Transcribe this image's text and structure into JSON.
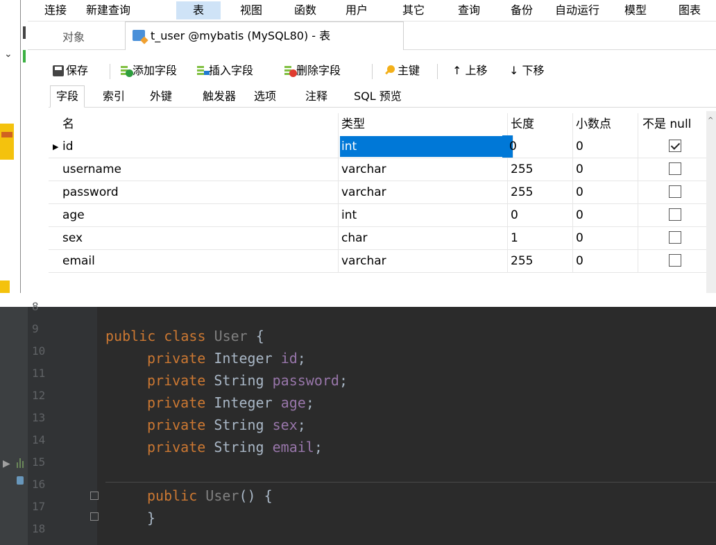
{
  "menubar": {
    "items": [
      "连接",
      "新建查询",
      "表",
      "视图",
      "函数",
      "用户",
      "其它",
      "查询",
      "备份",
      "自动运行",
      "模型",
      "图表"
    ],
    "active": "表"
  },
  "tabs": {
    "objects": "对象",
    "table_tab": "t_user @mybatis (MySQL80) - 表"
  },
  "toolbar": {
    "save": "保存",
    "add_field": "添加字段",
    "insert_field": "插入字段",
    "delete_field": "删除字段",
    "primary_key": "主键",
    "move_up": "↑ 上移",
    "move_down": "↓ 下移"
  },
  "subtabs": [
    "字段",
    "索引",
    "外键",
    "触发器",
    "选项",
    "注释",
    "SQL 预览"
  ],
  "grid": {
    "headers": [
      "名",
      "类型",
      "长度",
      "小数点",
      "不是 null"
    ],
    "rows": [
      {
        "name": "id",
        "type": "int",
        "length": "0",
        "decimals": "0",
        "not_null": true
      },
      {
        "name": "username",
        "type": "varchar",
        "length": "255",
        "decimals": "0",
        "not_null": false
      },
      {
        "name": "password",
        "type": "varchar",
        "length": "255",
        "decimals": "0",
        "not_null": false
      },
      {
        "name": "age",
        "type": "int",
        "length": "0",
        "decimals": "0",
        "not_null": false
      },
      {
        "name": "sex",
        "type": "char",
        "length": "1",
        "decimals": "0",
        "not_null": false
      },
      {
        "name": "email",
        "type": "varchar",
        "length": "255",
        "decimals": "0",
        "not_null": false
      }
    ]
  },
  "editor": {
    "line_numbers": [
      "8",
      "9",
      "10",
      "11",
      "12",
      "13",
      "14",
      "15",
      "16",
      "17",
      "18"
    ],
    "class_decl": {
      "kw1": "public",
      "kw2": "class",
      "name": "User",
      "brace": "{"
    },
    "fields": [
      {
        "kw": "private",
        "type": "Integer",
        "name": "id",
        "end": ";"
      },
      {
        "kw": "private",
        "type": "String",
        "name": "password",
        "end": ";"
      },
      {
        "kw": "private",
        "type": "Integer",
        "name": "age",
        "end": ";"
      },
      {
        "kw": "private",
        "type": "String",
        "name": "sex",
        "end": ";"
      },
      {
        "kw": "private",
        "type": "String",
        "name": "email",
        "end": ";"
      }
    ],
    "constructor": {
      "kw": "public",
      "name": "User",
      "rest": "() {"
    },
    "closing": "}"
  }
}
